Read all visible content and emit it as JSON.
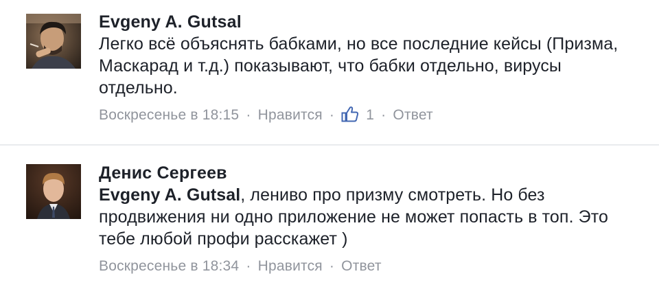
{
  "comments": [
    {
      "author": "Evgeny A. Gutsal",
      "text": "Легко всё объяснять бабками, но все последние кейсы (Призма, Маскарад и т.д.) показывают, что бабки отдельно, вирусы отдельно.",
      "timestamp": "Воскресенье в 18:15",
      "like_label": "Нравится",
      "like_count": "1",
      "reply_label": "Ответ",
      "separator": "·"
    },
    {
      "author": "Денис Сергеев",
      "mention": "Evgeny A. Gutsal",
      "text": ", лениво про призму смотреть. Но без продвижения ни одно приложение не может попасть в топ. Это тебе любой профи расскажет )",
      "timestamp": "Воскресенье в 18:34",
      "like_label": "Нравится",
      "reply_label": "Ответ",
      "separator": "·"
    }
  ],
  "icons": {
    "like": "thumbs-up-icon"
  },
  "colors": {
    "text": "#1d2129",
    "meta": "#90949c",
    "like_icon": "#4267b2",
    "divider": "#e9ebee"
  }
}
